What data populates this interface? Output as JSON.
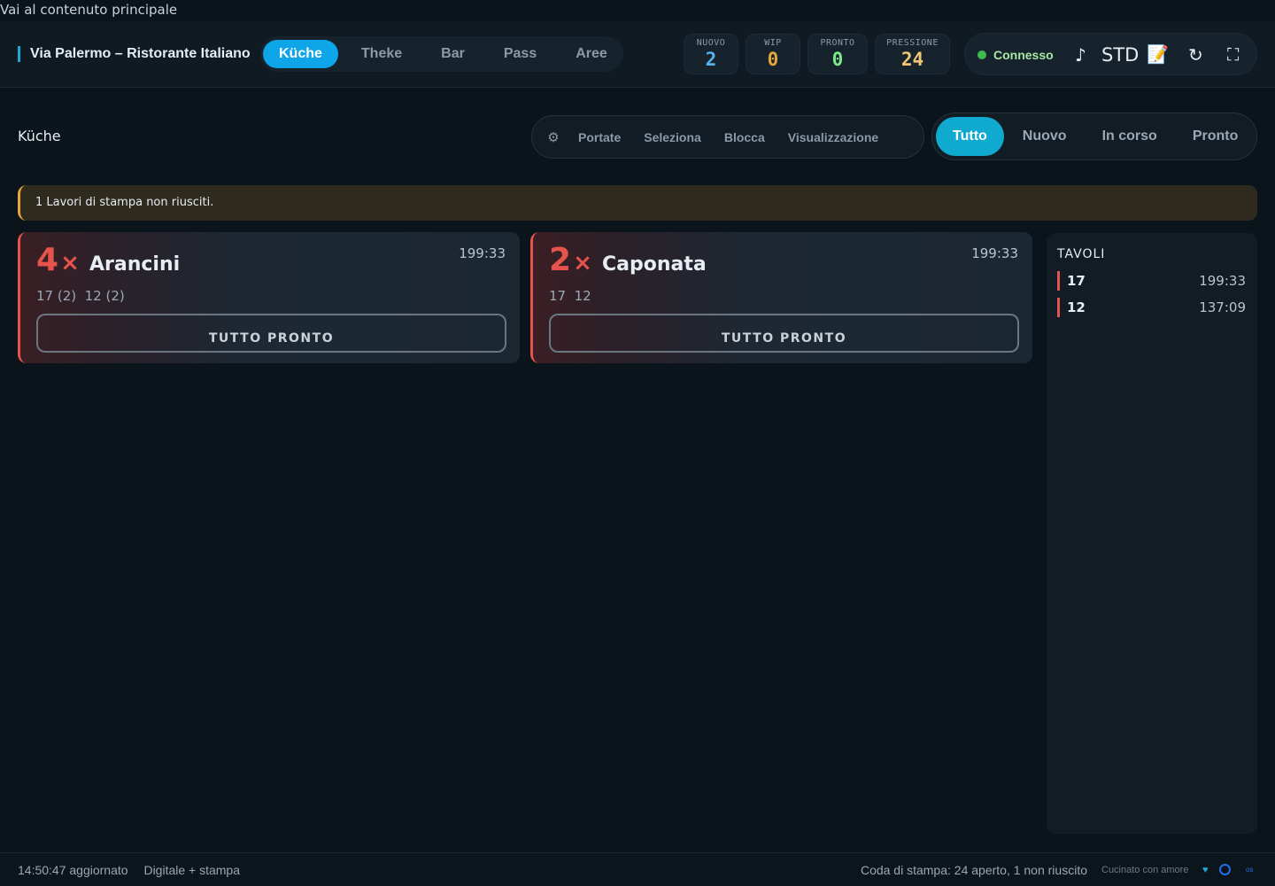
{
  "skip_link": "Vai al contenuto principale",
  "header": {
    "venue": "Via Palermo – Ristorante Italiano",
    "stations": [
      {
        "label": "Küche",
        "active": true
      },
      {
        "label": "Theke",
        "active": false
      },
      {
        "label": "Bar",
        "active": false
      },
      {
        "label": "Pass",
        "active": false
      },
      {
        "label": "Aree",
        "active": false
      }
    ],
    "metrics": [
      {
        "label": "NUOVO",
        "value": "2",
        "color": "#58b4f0"
      },
      {
        "label": "WIP",
        "value": "0",
        "color": "#e3a73a"
      },
      {
        "label": "PRONTO",
        "value": "0",
        "color": "#7ee787"
      },
      {
        "label": "PRESSIONE",
        "value": "24",
        "color": "#f0c674"
      }
    ],
    "connection": {
      "label": "Connesso",
      "color": "#3fb950"
    },
    "icons": {
      "music": "♪",
      "std": "STD",
      "notes": "📝",
      "refresh": "↻",
      "fullscreen": "⛶"
    }
  },
  "toolbar": {
    "station_title": "Küche",
    "gear_icon": "⚙",
    "actions": [
      "Portate",
      "Seleziona",
      "Blocca",
      "Visualizzazione"
    ],
    "filters": [
      {
        "label": "Tutto",
        "active": true
      },
      {
        "label": "Nuovo",
        "active": false
      },
      {
        "label": "In corso",
        "active": false
      },
      {
        "label": "Pronto",
        "active": false
      }
    ]
  },
  "alert": {
    "text": "1 Lavori di stampa non riusciti."
  },
  "cards": [
    {
      "qty": "4",
      "qty_symbol": "×",
      "name": "Arancini",
      "time": "199:33",
      "tables": "17 (2)  12 (2)",
      "action": "TUTTO PRONTO"
    },
    {
      "qty": "2",
      "qty_symbol": "×",
      "name": "Caponata",
      "time": "199:33",
      "tables": "17  12",
      "action": "TUTTO PRONTO"
    }
  ],
  "tables_panel": {
    "title": "TAVOLI",
    "rows": [
      {
        "number": "17",
        "time": "199:33"
      },
      {
        "number": "12",
        "time": "137:09"
      }
    ]
  },
  "footer": {
    "updated": "14:50:47 aggiornato",
    "mode": "Digitale + stampa",
    "print_queue": "Coda di stampa: 24 aperto, 1 non riuscito",
    "love": "Cucinato con amore",
    "heart": "♥",
    "os": "os"
  }
}
